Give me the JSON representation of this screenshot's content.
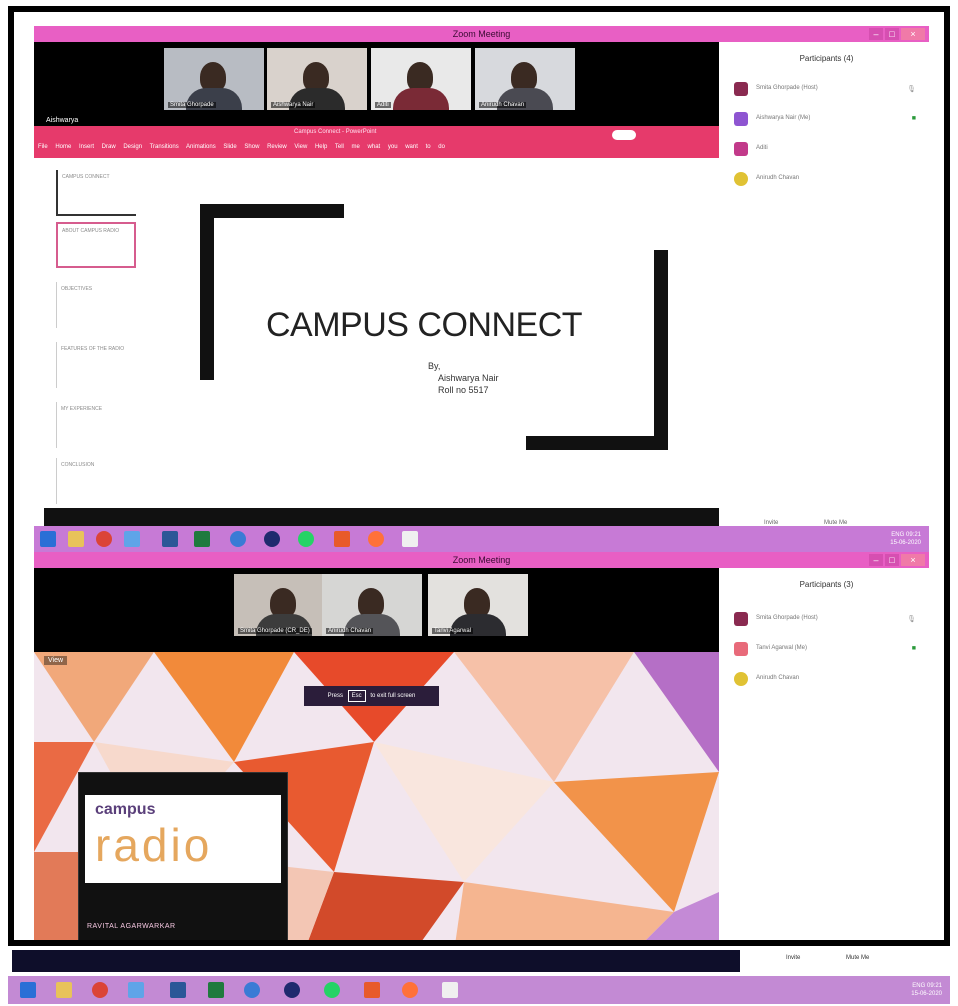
{
  "window_top": {
    "title": "Zoom Meeting",
    "participants_header": "Participants (4)",
    "video_tiles": [
      {
        "name": "Smita Ghorpade"
      },
      {
        "name": "Aishwarya Nair"
      },
      {
        "name": "Aditi"
      },
      {
        "name": "Anirudh Chavan"
      }
    ],
    "self_name": "Aishwarya",
    "ribbon_title": "Campus Connect - PowerPoint",
    "ribbon_tabs": "File Home Insert Draw Design Transitions Animations Slide Show Review View Help Tell me what you want to do",
    "slide": {
      "title": "CAMPUS CONNECT",
      "by_label": "By,",
      "author": "Aishwarya Nair",
      "roll": "Roll no 5517"
    },
    "thumbnails": [
      {
        "text": "CAMPUS CONNECT"
      },
      {
        "text": "ABOUT CAMPUS RADIO"
      },
      {
        "text": "OBJECTIVES"
      },
      {
        "text": "FEATURES OF THE RADIO"
      },
      {
        "text": "MY EXPERIENCE"
      },
      {
        "text": "CONCLUSION"
      }
    ],
    "participants": [
      {
        "name": "Smita Ghorpade (Host)",
        "color": "#8a2a50"
      },
      {
        "name": "Aishwarya Nair (Me)",
        "color": "#8e55d1"
      },
      {
        "name": "Aditi",
        "color": "#c23a8a"
      },
      {
        "name": "Anirudh Chavan",
        "color": "#e0c234"
      }
    ],
    "footer": {
      "invite": "Invite",
      "mute_me": "Mute Me"
    }
  },
  "window_bottom": {
    "title": "Zoom Meeting",
    "participants_header": "Participants (3)",
    "video_tiles": [
      {
        "name": "Smita Ghorpade (CR_DE)"
      },
      {
        "name": "Anirudh Chavan"
      },
      {
        "name": "Tanvi Agarwal"
      }
    ],
    "view_label": "View",
    "share_bar": {
      "prefix": "Press",
      "key": "Esc",
      "suffix": "to exit full screen"
    },
    "radio": {
      "campus": "campus",
      "radio": "radio",
      "name": "RAVITAL AGARWARKAR"
    },
    "participants": [
      {
        "name": "Smita Ghorpade (Host)",
        "color": "#8a2a50"
      },
      {
        "name": "Tanvi Agarwal (Me)",
        "color": "#e86a7a"
      },
      {
        "name": "Anirudh Chavan",
        "color": "#e0c234"
      }
    ],
    "footer": {
      "invite": "Invite",
      "mute_me": "Mute Me"
    }
  },
  "taskbar": {
    "lang": "ENG",
    "time": "09:21",
    "date": "15-06-2020"
  }
}
